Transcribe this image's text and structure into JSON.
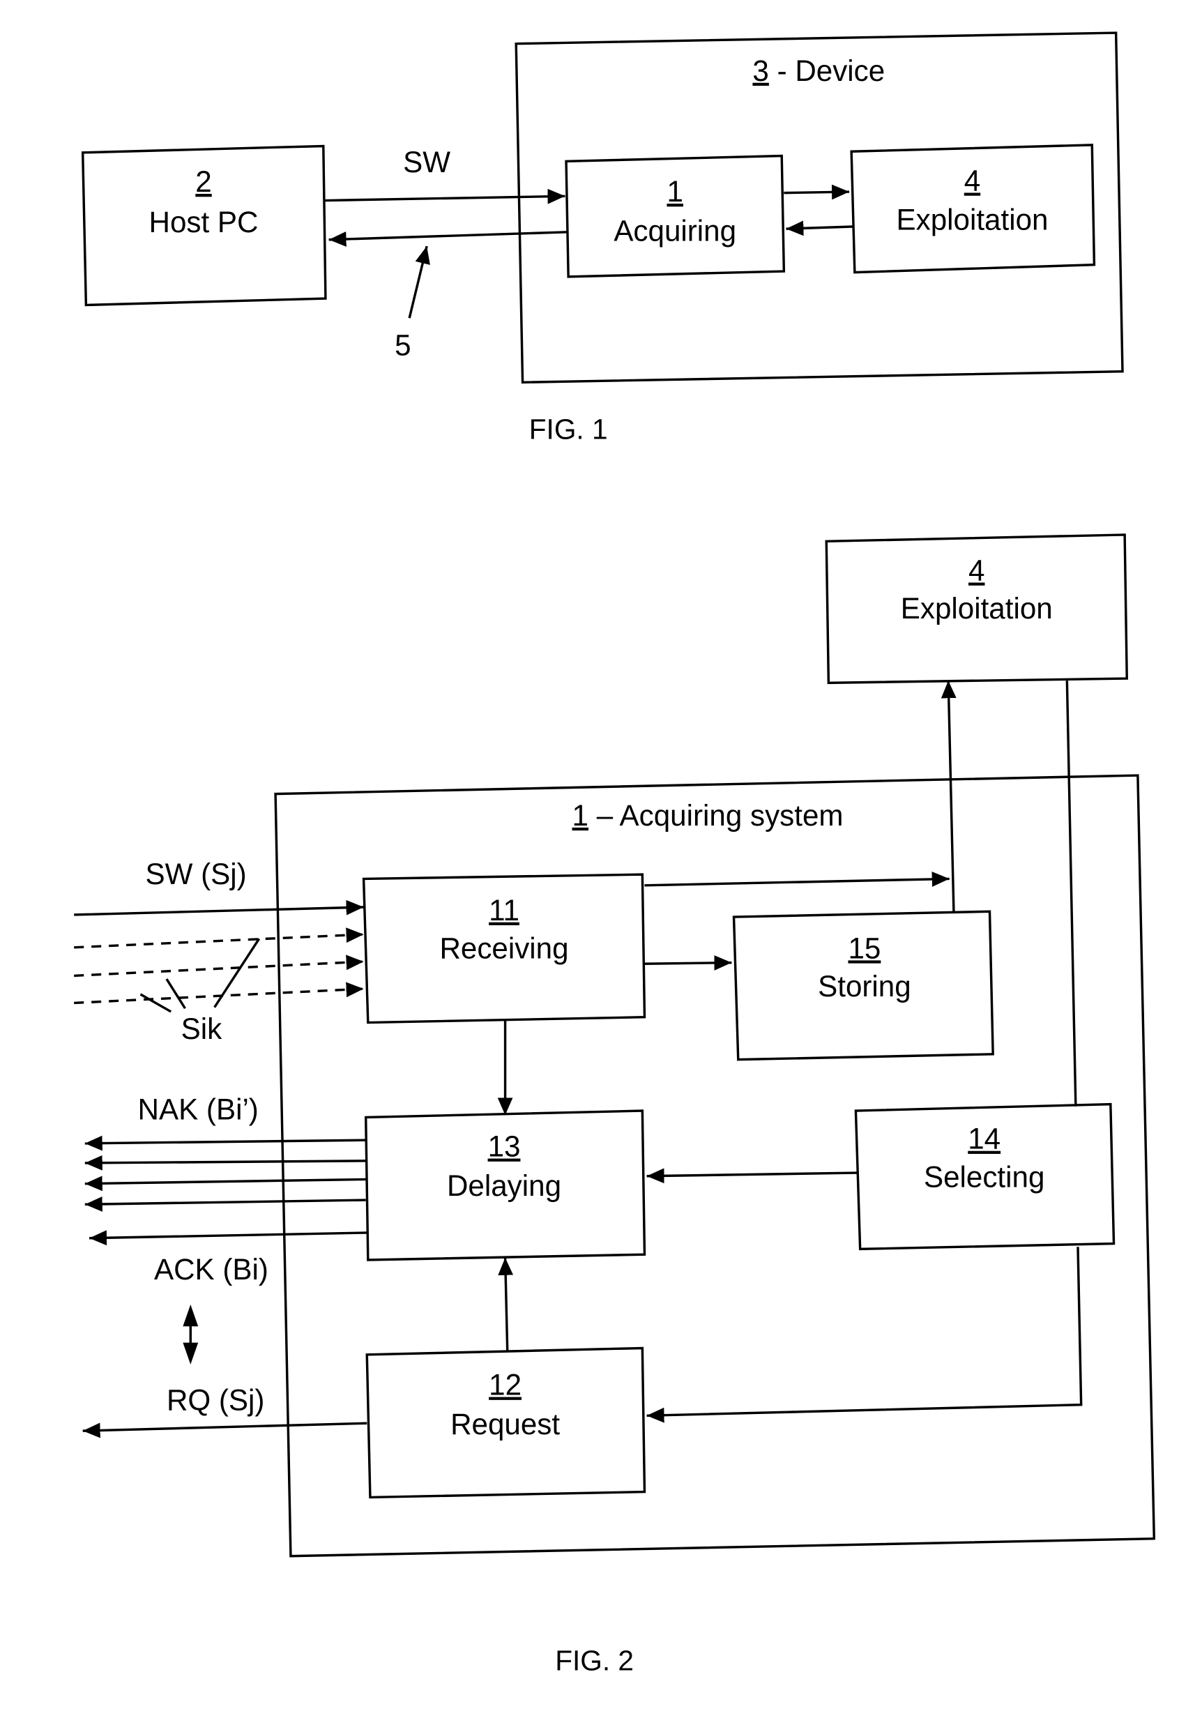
{
  "fig1": {
    "caption": "FIG. 1",
    "device": {
      "num": "3",
      "label": " - Device"
    },
    "host_pc": {
      "num": "2",
      "label": "Host PC"
    },
    "acquiring": {
      "num": "1",
      "label": "Acquiring"
    },
    "exploitation": {
      "num": "4",
      "label": "Exploitation"
    },
    "sw_label": "SW",
    "link_ref": "5"
  },
  "fig2": {
    "caption": "FIG. 2",
    "acquiring_system": {
      "num": "1",
      "label": " – Acquiring system"
    },
    "exploitation": {
      "num": "4",
      "label": "Exploitation"
    },
    "receiving": {
      "num": "11",
      "label": "Receiving"
    },
    "storing": {
      "num": "15",
      "label": "Storing"
    },
    "delaying": {
      "num": "13",
      "label": "Delaying"
    },
    "selecting": {
      "num": "14",
      "label": "Selecting"
    },
    "request": {
      "num": "12",
      "label": "Request"
    },
    "signals": {
      "sw": "SW (Sj)",
      "sik": "Sik",
      "nak": "NAK (Bi’)",
      "ack": "ACK (Bi)",
      "rq": "RQ (Sj)"
    }
  }
}
